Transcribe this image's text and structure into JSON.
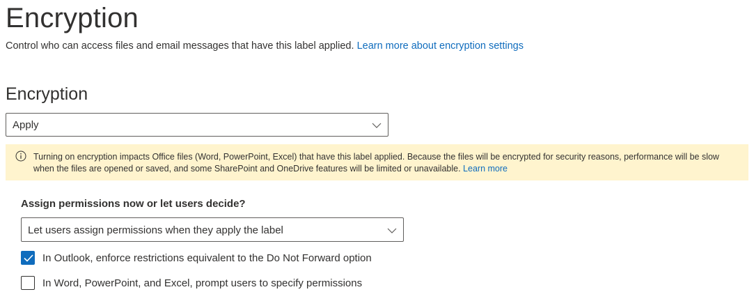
{
  "header": {
    "title": "Encryption",
    "description": "Control who can access files and email messages that have this label applied.",
    "learn_more_link": "Learn more about encryption settings"
  },
  "encryption_section": {
    "title": "Encryption",
    "dropdown_value": "Apply",
    "dropdown_icon": "chevron-down-icon"
  },
  "warning": {
    "icon": "info-icon",
    "message": "Turning on encryption impacts Office files (Word, PowerPoint, Excel) that have this label applied. Because the files will be encrypted for security reasons, performance will be slow when the files are opened or saved, and some SharePoint and OneDrive features will be limited or unavailable.",
    "learn_more": "Learn more",
    "background_color": "#fff4ce"
  },
  "permissions": {
    "label": "Assign permissions now or let users decide?",
    "dropdown_value": "Let users assign permissions when they apply the label",
    "options": [
      {
        "label": "In Outlook, enforce restrictions equivalent to the Do Not Forward option",
        "checked": true
      },
      {
        "label": "In Word, PowerPoint, and Excel, prompt users to specify permissions",
        "checked": false
      }
    ]
  },
  "colors": {
    "accent": "#0f6cbd",
    "text": "#323130"
  }
}
